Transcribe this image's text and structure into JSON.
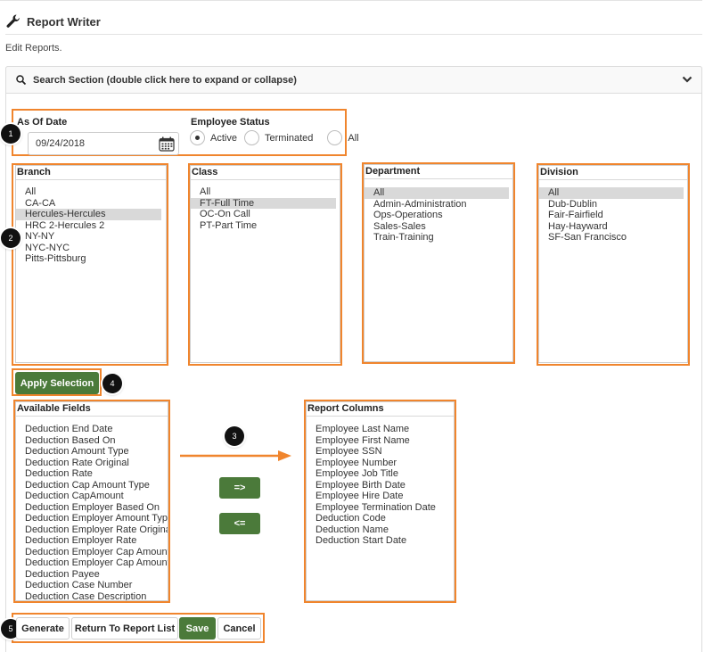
{
  "header": {
    "title": "Report Writer",
    "subtitle": "Edit Reports."
  },
  "search_section": {
    "title": "Search Section (double click here to expand or collapse)"
  },
  "as_of": {
    "label": "As Of Date",
    "value": "09/24/2018"
  },
  "employee_status": {
    "label": "Employee Status",
    "options": [
      "Active",
      "Terminated",
      "All"
    ],
    "selected": "Active"
  },
  "branch": {
    "label": "Branch",
    "items": [
      "All",
      "CA-CA",
      "Hercules-Hercules",
      "HRC 2-Hercules 2",
      "NY-NY",
      "NYC-NYC",
      "Pitts-Pittsburg"
    ],
    "selected": "Hercules-Hercules"
  },
  "class": {
    "label": "Class",
    "items": [
      "All",
      "FT-Full Time",
      "OC-On Call",
      "PT-Part Time"
    ],
    "selected": "FT-Full Time"
  },
  "department": {
    "label": "Department",
    "items": [
      "All",
      "Admin-Administration",
      "Ops-Operations",
      "Sales-Sales",
      "Train-Training"
    ],
    "selected": "All"
  },
  "division": {
    "label": "Division",
    "items": [
      "All",
      "Dub-Dublin",
      "Fair-Fairfield",
      "Hay-Hayward",
      "SF-San Francisco"
    ],
    "selected": "All"
  },
  "apply_selection_label": "Apply Selection",
  "available_fields": {
    "label": "Available Fields",
    "items": [
      "Deduction End Date",
      "Deduction Based On",
      "Deduction Amount Type",
      "Deduction Rate Original",
      "Deduction Rate",
      "Deduction Cap Amount Type",
      "Deduction CapAmount",
      "Deduction Employer Based On",
      "Deduction Employer Amount Type",
      "Deduction Employer Rate Original",
      "Deduction Employer Rate",
      "Deduction Employer Cap Amount Ty",
      "Deduction Employer Cap Amount",
      "Deduction Payee",
      "Deduction Case Number",
      "Deduction Case Description"
    ]
  },
  "report_columns": {
    "label": "Report Columns",
    "items": [
      "Employee Last Name",
      "Employee First Name",
      "Employee SSN",
      "Employee Number",
      "Employee Job Title",
      "Employee Birth Date",
      "Employee Hire Date",
      "Employee Termination Date",
      "Deduction Code",
      "Deduction Name",
      "Deduction Start Date"
    ]
  },
  "move_right_label": "=>",
  "move_left_label": "<=",
  "footer_buttons": {
    "generate": "Generate",
    "return": "Return To Report List",
    "save": "Save",
    "cancel": "Cancel"
  },
  "callouts": {
    "c1": "1",
    "c2": "2",
    "c3": "3",
    "c4": "4",
    "c5": "5"
  },
  "colors": {
    "highlight": "#f0852d",
    "button_green": "#4b7a3a"
  }
}
